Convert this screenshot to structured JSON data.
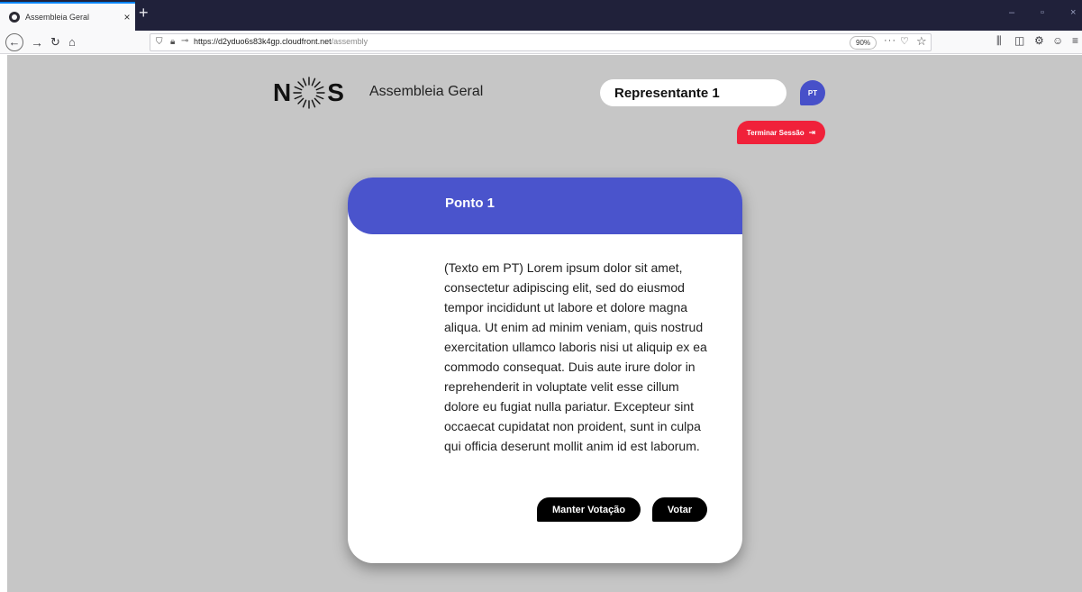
{
  "browser": {
    "tab_title": "Assembleia Geral",
    "tab_close": "×",
    "new_tab": "+",
    "url_host": "https://d2yduo6s83k4gp.cloudfront.net",
    "url_path": "/assembly",
    "zoom": "90%",
    "more": "···",
    "window_controls": [
      "–",
      "▫",
      "×"
    ]
  },
  "header": {
    "logo_left": "N",
    "logo_right": "S",
    "app_title": "Assembleia Geral",
    "representative": "Representante 1",
    "language": "PT",
    "logout_label": "Terminar Sessão"
  },
  "card": {
    "title": "Ponto 1",
    "body": "(Texto em PT) Lorem ipsum dolor sit amet, consectetur adipiscing elit, sed do eiusmod tempor incididunt ut labore et dolore magna aliqua. Ut enim ad minim veniam, quis nostrud exercitation ullamco laboris nisi ut aliquip ex ea commodo consequat. Duis aute irure dolor in reprehenderit in voluptate velit esse cillum dolore eu fugiat nulla pariatur. Excepteur sint occaecat cupidatat non proident, sunt in culpa qui officia deserunt mollit anim id est laborum.",
    "keep_vote_label": "Manter Votação",
    "vote_label": "Votar"
  },
  "colors": {
    "accent_blue": "#4a54cc",
    "logout_red": "#f0213a",
    "page_bg": "#c6c6c6",
    "tabbar_bg": "#20213a"
  }
}
